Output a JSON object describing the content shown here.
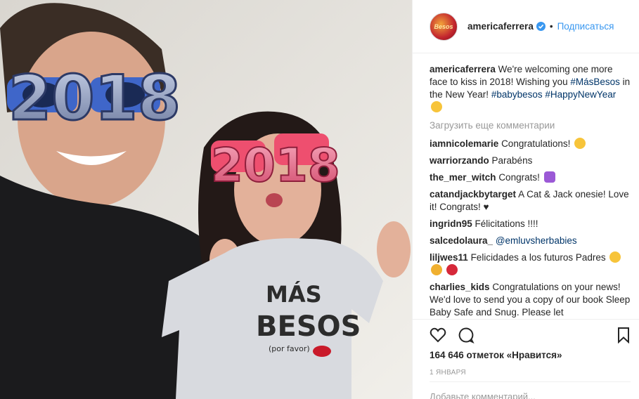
{
  "post": {
    "username": "americaferrera",
    "follow_label": "Подписаться",
    "separator": "•",
    "avatar_text": "Besos"
  },
  "caption": {
    "username": "americaferrera",
    "text": "We're welcoming one more face to kiss in 2018! Wishing you",
    "tag1": "#MásBesos",
    "text2": " in the New Year! ",
    "tag2": "#babybesos",
    "tag3": "#HappyNewYear"
  },
  "load_more": "Загрузить еще комментарии",
  "comments": [
    {
      "user": "iamnicolemarie",
      "text": "Congratulations!"
    },
    {
      "user": "warriorzando",
      "text": "Parabéns"
    },
    {
      "user": "the_mer_witch",
      "text": "Congrats!"
    },
    {
      "user": "catandjackbytarget",
      "text": "A Cat & Jack onesie! Love it! Congrats! ♥"
    },
    {
      "user": "ingridn95",
      "text": "Félicitations !!!!"
    },
    {
      "user": "salcedolaura_",
      "text": "@emluvsherbabies"
    },
    {
      "user": "liljwes11",
      "text": "Felicidades a los futuros Padres"
    },
    {
      "user": "charlies_kids",
      "text": "Congratulations on your news! We'd love to send you a copy of our book Sleep Baby Safe and Snug. Please let"
    }
  ],
  "likes": "164 646 отметок «Нравится»",
  "date": "1 ЯНВАРЯ",
  "add_comment_placeholder": "Добавьте комментарий...",
  "photo": {
    "glasses_text": "2018",
    "shirt_line1": "MÁS",
    "shirt_line2": "BESOS",
    "shirt_line3": "(por favor)"
  },
  "colors": {
    "link": "#003569",
    "follow": "#3897f0",
    "muted": "#999999"
  }
}
